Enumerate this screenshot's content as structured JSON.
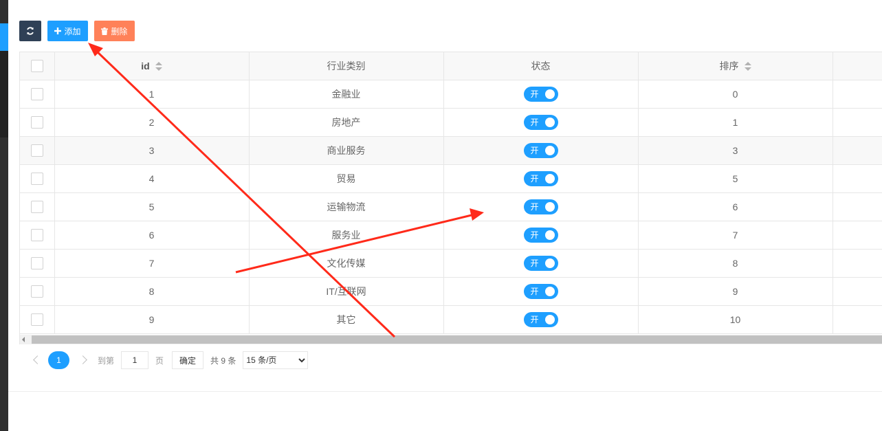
{
  "toolbar": {
    "add_label": "添加",
    "delete_label": "删除"
  },
  "table": {
    "headers": {
      "id": "id",
      "category": "行业类别",
      "status": "状态",
      "sort": "排序"
    },
    "rows": [
      {
        "id": "1",
        "category": "金融业",
        "status": "开",
        "sort": "0"
      },
      {
        "id": "2",
        "category": "房地产",
        "status": "开",
        "sort": "1"
      },
      {
        "id": "3",
        "category": "商业服务",
        "status": "开",
        "sort": "3"
      },
      {
        "id": "4",
        "category": "贸易",
        "status": "开",
        "sort": "5"
      },
      {
        "id": "5",
        "category": "运输物流",
        "status": "开",
        "sort": "6"
      },
      {
        "id": "6",
        "category": "服务业",
        "status": "开",
        "sort": "7"
      },
      {
        "id": "7",
        "category": "文化传媒",
        "status": "开",
        "sort": "8"
      },
      {
        "id": "8",
        "category": "IT/互联网",
        "status": "开",
        "sort": "9"
      },
      {
        "id": "9",
        "category": "其它",
        "status": "开",
        "sort": "10"
      }
    ]
  },
  "pager": {
    "current_page": "1",
    "goto_prefix": "到第",
    "goto_value": "1",
    "goto_suffix": "页",
    "confirm_label": "确定",
    "total_text": "共 9 条",
    "page_size": "15 条/页"
  },
  "colors": {
    "primary": "#1e9fff",
    "dark_button": "#2f4056",
    "danger": "#ff5722",
    "annotation_arrow": "#ff2a1a"
  }
}
